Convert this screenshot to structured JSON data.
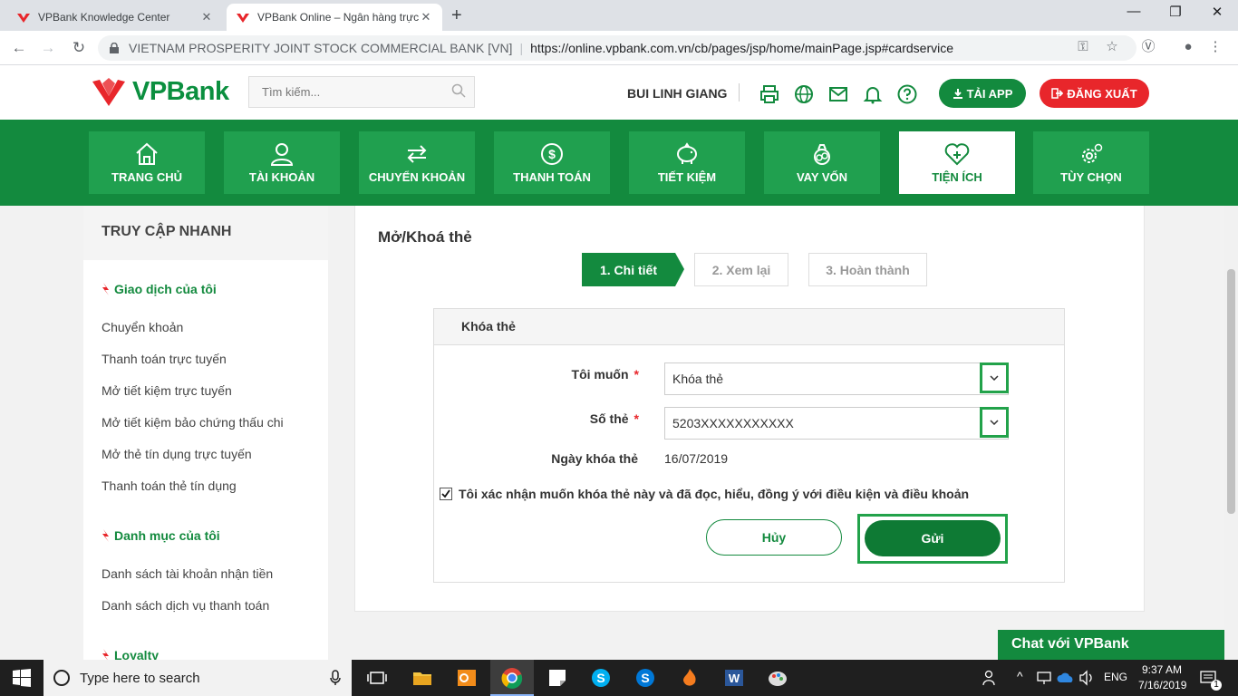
{
  "browser": {
    "tabs": [
      {
        "title": "VPBank Knowledge Center",
        "close": "✕"
      },
      {
        "title": "VPBank Online – Ngân hàng trực",
        "close": "✕"
      }
    ],
    "new_tab": "+",
    "window_controls": [
      "—",
      "❐",
      "✕"
    ],
    "cert_name": "VIETNAM PROSPERITY JOINT STOCK COMMERCIAL BANK [VN]",
    "separator": "|",
    "url": "https://online.vpbank.com.vn/cb/pages/jsp/home/mainPage.jsp#cardservice"
  },
  "header": {
    "logo_text": "VPBank",
    "search_placeholder": "Tìm kiếm...",
    "user_name": "BUI LINH GIANG",
    "icons": [
      "printer-icon",
      "globe-icon",
      "mail-icon",
      "bell-icon",
      "help-icon"
    ],
    "app_button": "TẢI APP",
    "logout_button": "ĐĂNG XUẤT"
  },
  "nav": {
    "items": [
      {
        "label": "TRANG CHỦ",
        "icon": "home-icon"
      },
      {
        "label": "TÀI KHOẢN",
        "icon": "user-icon"
      },
      {
        "label": "CHUYỂN KHOẢN",
        "icon": "transfer-icon"
      },
      {
        "label": "THANH TOÁN",
        "icon": "dollar-icon"
      },
      {
        "label": "TIẾT KIỆM",
        "icon": "piggy-bank-icon"
      },
      {
        "label": "VAY VỐN",
        "icon": "loan-icon"
      },
      {
        "label": "TIỆN ÍCH",
        "icon": "heart-plus-icon"
      },
      {
        "label": "TÙY CHỌN",
        "icon": "settings-icon"
      }
    ],
    "active_index": 6
  },
  "sidebar": {
    "title": "TRUY CẬP NHANH",
    "sections": [
      {
        "title": "Giao dịch của tôi",
        "links": [
          "Chuyển khoản",
          "Thanh toán trực tuyến",
          "Mở tiết kiệm trực tuyến",
          "Mở tiết kiệm bảo chứng thấu chi",
          "Mở thẻ tín dụng trực tuyến",
          "Thanh toán thẻ tín dụng"
        ]
      },
      {
        "title": "Danh mục của tôi",
        "links": [
          "Danh sách tài khoản nhận tiền",
          "Danh sách dịch vụ thanh toán"
        ]
      },
      {
        "title": "Loyalty",
        "links": []
      }
    ]
  },
  "page": {
    "title": "Mở/Khoá thẻ",
    "steps": [
      "1. Chi tiết",
      "2. Xem lại",
      "3. Hoàn thành"
    ],
    "card_title": "Khóa thẻ",
    "fields": {
      "action_label": "Tôi muốn",
      "action_value": "Khóa thẻ",
      "card_label": "Số thẻ",
      "card_value": "5203XXXXXXXXXXX",
      "date_label": "Ngày khóa thẻ",
      "date_value": "16/07/2019",
      "required_mark": "*"
    },
    "confirm_text": "Tôi xác nhận muốn khóa thẻ này và đã đọc, hiểu, đồng ý với điều kiện và điều khoản",
    "confirm_checked": true,
    "cancel_button": "Hủy",
    "submit_button": "Gửi"
  },
  "chat": {
    "label": "Chat với VPBank"
  },
  "taskbar": {
    "search_placeholder": "Type here to search",
    "language": "ENG",
    "time": "9:37 AM",
    "date": "7/16/2019",
    "notification_count": "1"
  },
  "colors": {
    "brand_green": "#138a3e",
    "brand_red": "#e8262b",
    "highlight_green": "#22a24a"
  }
}
